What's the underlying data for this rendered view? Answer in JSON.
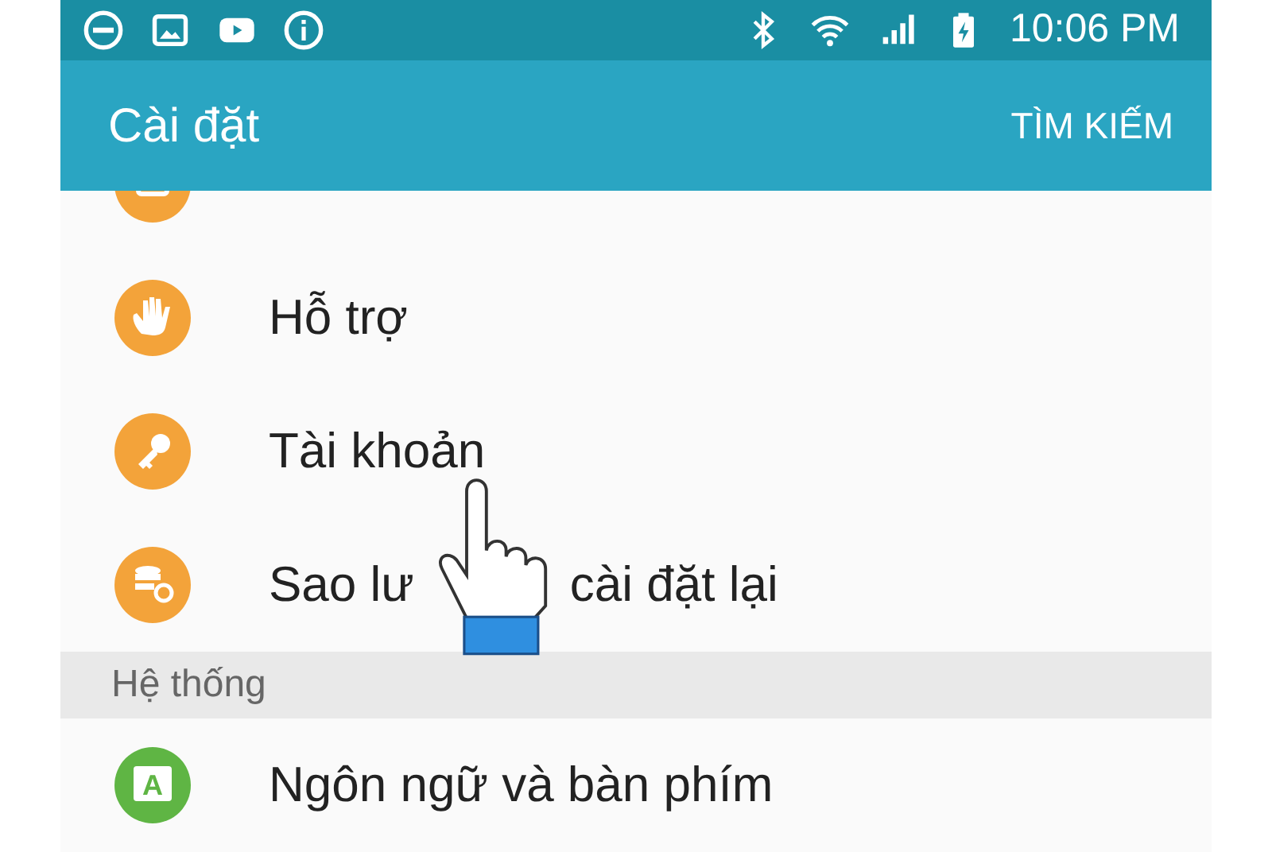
{
  "status_bar": {
    "time": "10:06 PM"
  },
  "app_bar": {
    "title": "Cài đặt",
    "action": "TÌM KIẾM"
  },
  "list": [
    {
      "kind": "item",
      "color": "#f3a33a"
    },
    {
      "kind": "item",
      "label_parts": [
        "Hỗ trợ"
      ],
      "color": "#f3a33a"
    },
    {
      "kind": "item",
      "label_parts": [
        "Tài khoản"
      ],
      "color": "#f3a33a"
    },
    {
      "kind": "item",
      "label_parts": [
        "Sao lư",
        "cài đặt lại"
      ],
      "color": "#f3a33a"
    },
    {
      "kind": "header",
      "label": "Hệ thống"
    },
    {
      "kind": "item",
      "label_parts": [
        "Ngôn ngữ và bàn phím"
      ],
      "color": "#5fb544",
      "icon_text": "A"
    }
  ]
}
